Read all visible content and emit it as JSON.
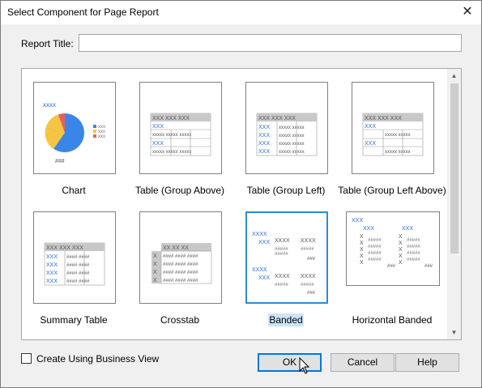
{
  "window": {
    "title": "Select Component for Page Report",
    "close_glyph": "✕"
  },
  "report_title": {
    "label": "Report Title:",
    "value": ""
  },
  "components": [
    {
      "label": "Chart",
      "icon": "pie-chart-icon",
      "header": "xxxx",
      "footer": "###"
    },
    {
      "label": "Table (Group Above)",
      "icon": "table-group-above-icon"
    },
    {
      "label": "Table (Group Left)",
      "icon": "table-group-left-icon"
    },
    {
      "label": "Table (Group Left Above)",
      "icon": "table-group-left-above-icon"
    },
    {
      "label": "Summary Table",
      "icon": "summary-table-icon"
    },
    {
      "label": "Crosstab",
      "icon": "crosstab-icon"
    },
    {
      "label": "Banded",
      "icon": "banded-icon",
      "selected": true
    },
    {
      "label": "Horizontal Banded",
      "icon": "horizontal-banded-icon"
    }
  ],
  "glyphs": {
    "x": "XXX",
    "x_small": "xxx",
    "hash": "####",
    "blue_x": "XXX",
    "chart_legend": "xxx"
  },
  "business_view": {
    "label": "Create Using Business View",
    "checked": false
  },
  "buttons": {
    "ok": "OK",
    "cancel": "Cancel",
    "help": "Help"
  },
  "colors": {
    "accent": "#0078d7",
    "selection": "#cce4f7",
    "pie_blue": "#3a86e8",
    "pie_yellow": "#f5c542",
    "pie_red": "#e85f5f",
    "xx_blue": "#2a6fd6"
  }
}
